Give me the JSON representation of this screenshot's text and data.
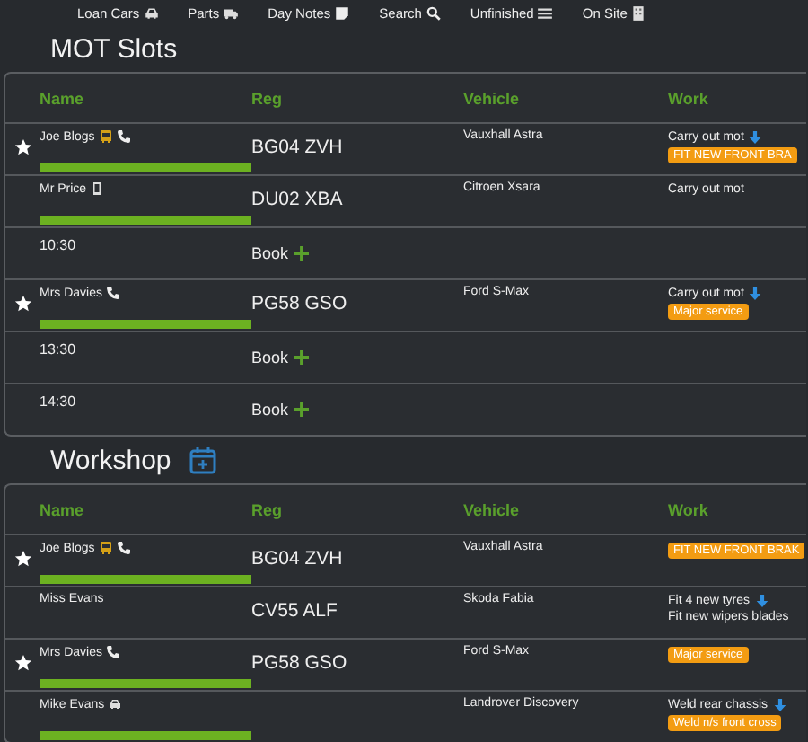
{
  "nav": [
    {
      "label": "Loan Cars"
    },
    {
      "label": "Parts"
    },
    {
      "label": "Day Notes"
    },
    {
      "label": "Search"
    },
    {
      "label": "Unfinished"
    },
    {
      "label": "On Site"
    }
  ],
  "sections": [
    {
      "title": "MOT Slots",
      "add_icon": false,
      "columns": [
        "Name",
        "Reg",
        "Vehicle",
        "Work"
      ],
      "rows": [
        {
          "kind": "booking",
          "starred": true,
          "name": "Joe Blogs",
          "waiting": true,
          "phone": true,
          "mobile": false,
          "loan_car": false,
          "bar": true,
          "reg": "BG04 ZVH",
          "vehicle": "Vauxhall Astra",
          "work": [
            {
              "kind": "text",
              "text": "Carry out mot",
              "expandable": true
            },
            {
              "kind": "tag",
              "text": "FIT NEW FRONT BRA"
            }
          ]
        },
        {
          "kind": "booking",
          "starred": false,
          "name": "Mr Price",
          "waiting": false,
          "phone": false,
          "mobile": true,
          "loan_car": false,
          "bar": true,
          "reg": "DU02 XBA",
          "vehicle": "Citroen Xsara",
          "work": [
            {
              "kind": "text",
              "text": "Carry out mot",
              "expandable": false
            }
          ]
        },
        {
          "kind": "slot",
          "time": "10:30",
          "action": "Book"
        },
        {
          "kind": "booking",
          "starred": true,
          "name": "Mrs Davies",
          "waiting": false,
          "phone": true,
          "mobile": false,
          "loan_car": false,
          "bar": true,
          "reg": "PG58 GSO",
          "vehicle": "Ford S-Max",
          "work": [
            {
              "kind": "text",
              "text": "Carry out mot",
              "expandable": true
            },
            {
              "kind": "tag",
              "text": "Major service"
            }
          ]
        },
        {
          "kind": "slot",
          "time": "13:30",
          "action": "Book"
        },
        {
          "kind": "slot",
          "time": "14:30",
          "action": "Book"
        }
      ]
    },
    {
      "title": "Workshop",
      "add_icon": true,
      "columns": [
        "Name",
        "Reg",
        "Vehicle",
        "Work"
      ],
      "rows": [
        {
          "kind": "booking",
          "starred": true,
          "name": "Joe Blogs",
          "waiting": true,
          "phone": true,
          "mobile": false,
          "loan_car": false,
          "bar": true,
          "reg": "BG04 ZVH",
          "vehicle": "Vauxhall Astra",
          "work": [
            {
              "kind": "tag",
              "text": "FIT NEW FRONT BRAK"
            }
          ]
        },
        {
          "kind": "booking",
          "starred": false,
          "name": "Miss Evans",
          "waiting": false,
          "phone": false,
          "mobile": false,
          "loan_car": false,
          "bar": false,
          "reg": "CV55 ALF",
          "vehicle": "Skoda Fabia",
          "work": [
            {
              "kind": "text",
              "text": "Fit 4 new tyres",
              "expandable": true
            },
            {
              "kind": "text",
              "text": "Fit new wipers blades",
              "expandable": false
            }
          ]
        },
        {
          "kind": "booking",
          "starred": true,
          "name": "Mrs Davies",
          "waiting": false,
          "phone": true,
          "mobile": false,
          "loan_car": false,
          "bar": true,
          "reg": "PG58 GSO",
          "vehicle": "Ford S-Max",
          "work": [
            {
              "kind": "tag",
              "text": "Major service"
            }
          ]
        },
        {
          "kind": "booking",
          "starred": false,
          "name": "Mike Evans",
          "waiting": false,
          "phone": false,
          "mobile": false,
          "loan_car": true,
          "bar": true,
          "reg": "",
          "vehicle": "Landrover Discovery",
          "work": [
            {
              "kind": "text",
              "text": "Weld rear chassis",
              "expandable": true
            },
            {
              "kind": "tag",
              "text": "Weld n/s front cross"
            }
          ]
        }
      ]
    }
  ]
}
